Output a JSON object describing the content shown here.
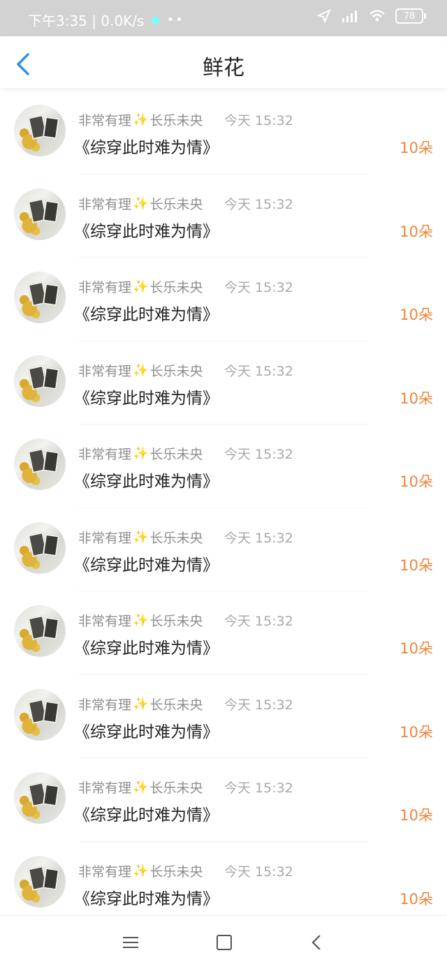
{
  "status_bar": {
    "time_speed": "下午3:35 | 0.0K/s",
    "dots": "••",
    "battery": "78"
  },
  "header": {
    "title": "鲜花"
  },
  "list": [
    {
      "user": "非常有理",
      "sparkle": "✨",
      "user2": "长乐未央",
      "time": "今天 15:32",
      "book": "《综穿此时难为情》",
      "count": "10朵"
    },
    {
      "user": "非常有理",
      "sparkle": "✨",
      "user2": "长乐未央",
      "time": "今天 15:32",
      "book": "《综穿此时难为情》",
      "count": "10朵"
    },
    {
      "user": "非常有理",
      "sparkle": "✨",
      "user2": "长乐未央",
      "time": "今天 15:32",
      "book": "《综穿此时难为情》",
      "count": "10朵"
    },
    {
      "user": "非常有理",
      "sparkle": "✨",
      "user2": "长乐未央",
      "time": "今天 15:32",
      "book": "《综穿此时难为情》",
      "count": "10朵"
    },
    {
      "user": "非常有理",
      "sparkle": "✨",
      "user2": "长乐未央",
      "time": "今天 15:32",
      "book": "《综穿此时难为情》",
      "count": "10朵"
    },
    {
      "user": "非常有理",
      "sparkle": "✨",
      "user2": "长乐未央",
      "time": "今天 15:32",
      "book": "《综穿此时难为情》",
      "count": "10朵"
    },
    {
      "user": "非常有理",
      "sparkle": "✨",
      "user2": "长乐未央",
      "time": "今天 15:32",
      "book": "《综穿此时难为情》",
      "count": "10朵"
    },
    {
      "user": "非常有理",
      "sparkle": "✨",
      "user2": "长乐未央",
      "time": "今天 15:32",
      "book": "《综穿此时难为情》",
      "count": "10朵"
    },
    {
      "user": "非常有理",
      "sparkle": "✨",
      "user2": "长乐未央",
      "time": "今天 15:32",
      "book": "《综穿此时难为情》",
      "count": "10朵"
    },
    {
      "user": "非常有理",
      "sparkle": "✨",
      "user2": "长乐未央",
      "time": "今天 15:32",
      "book": "《综穿此时难为情》",
      "count": "10朵"
    }
  ],
  "colors": {
    "accent": "#2f8fe6",
    "count": "#f0833a"
  }
}
